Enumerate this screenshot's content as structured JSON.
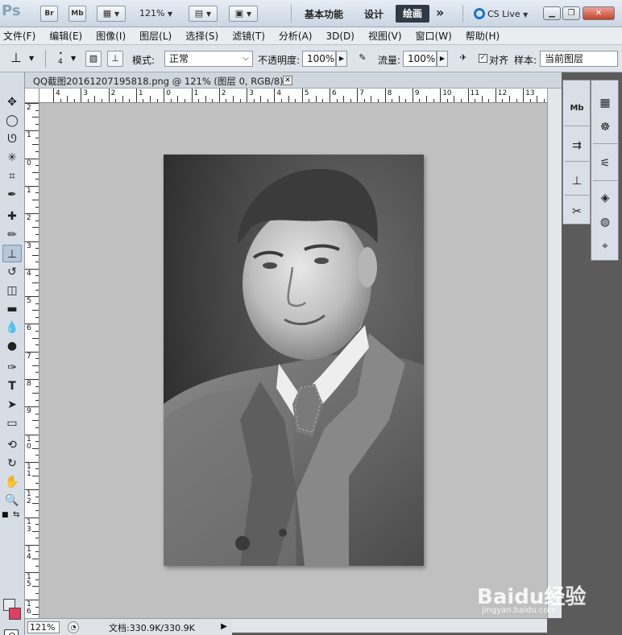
{
  "titlebar": {
    "logo": "Ps",
    "bridge": "Br",
    "minibridge": "Mb",
    "zoom": "121%",
    "workspaces": [
      "基本功能",
      "设计"
    ],
    "active_workspace": "绘画",
    "more": "»",
    "cslive": "CS Live"
  },
  "menu": [
    "文件(F)",
    "编辑(E)",
    "图像(I)",
    "图层(L)",
    "选择(S)",
    "滤镜(T)",
    "分析(A)",
    "3D(D)",
    "视图(V)",
    "窗口(W)",
    "帮助(H)"
  ],
  "options": {
    "brush_size": "4",
    "mode_label": "模式:",
    "mode_value": "正常",
    "opacity_label": "不透明度:",
    "opacity_value": "100%",
    "flow_label": "流量:",
    "flow_value": "100%",
    "aligned_label": "对齐",
    "sample_label": "样本:",
    "sample_value": "当前图层"
  },
  "document": {
    "tab_title": "QQ截图20161207195818.png @ 121% (图层 0, RGB/8) *",
    "ruler_h": [
      "4",
      "3",
      "2",
      "1",
      "0",
      "1",
      "2",
      "3",
      "4",
      "5",
      "6",
      "7",
      "8",
      "9",
      "10",
      "11",
      "12",
      "13"
    ],
    "ruler_v": [
      "2",
      "1",
      "0",
      "1",
      "2",
      "3",
      "4",
      "5",
      "6",
      "7",
      "8",
      "9",
      "1\n0",
      "1\n1",
      "1\n2",
      "1\n3",
      "1\n4",
      "1\n5",
      "1\n6"
    ]
  },
  "status": {
    "zoom": "121%",
    "doc": "文档:330.9K/330.9K"
  },
  "watermark": {
    "main": "Baidu经验",
    "sub": "jingyan.baidu.com"
  },
  "colors": {
    "foreground": "#eaeaf2",
    "background": "#e03d67"
  }
}
